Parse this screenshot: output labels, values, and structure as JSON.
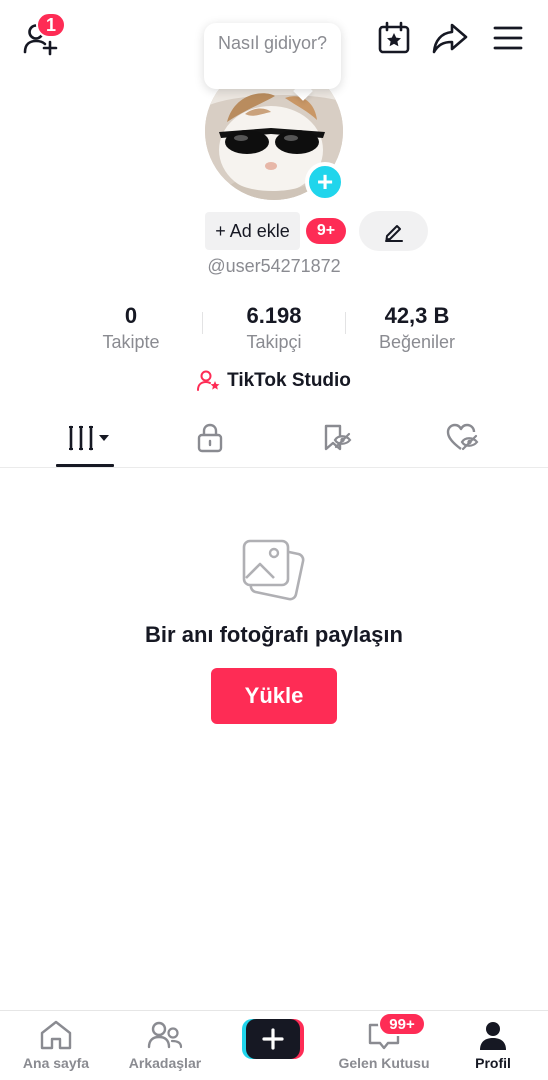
{
  "header": {
    "notification_count": "1",
    "bubble_text": "Nasıl gidiyor?"
  },
  "profile": {
    "add_name_label": "+ Ad ekle",
    "badge_count": "9+",
    "username": "@user54271872"
  },
  "stats": [
    {
      "value": "0",
      "label": "Takipte"
    },
    {
      "value": "6.198",
      "label": "Takipçi"
    },
    {
      "value": "42,3 B",
      "label": "Beğeniler"
    }
  ],
  "studio": {
    "label": "TikTok Studio"
  },
  "empty_state": {
    "title": "Bir anı fotoğrafı paylaşın",
    "button_label": "Yükle"
  },
  "bottom_nav": {
    "items": [
      {
        "label": "Ana sayfa"
      },
      {
        "label": "Arkadaşlar"
      },
      {
        "label": ""
      },
      {
        "label": "Gelen Kutusu"
      },
      {
        "label": "Profil"
      }
    ],
    "inbox_badge": "99+"
  },
  "colors": {
    "accent": "#fe2c55",
    "cyan": "#20d5ec",
    "text_primary": "#161823",
    "text_secondary": "#8a8b91"
  },
  "icons": [
    "add-friend-icon",
    "calendar-star-icon",
    "share-icon",
    "menu-icon",
    "lock-icon",
    "bookmark-eye-icon",
    "heart-eye-icon",
    "photo-icon",
    "home-icon",
    "friends-icon",
    "plus-icon",
    "inbox-icon",
    "profile-icon"
  ]
}
